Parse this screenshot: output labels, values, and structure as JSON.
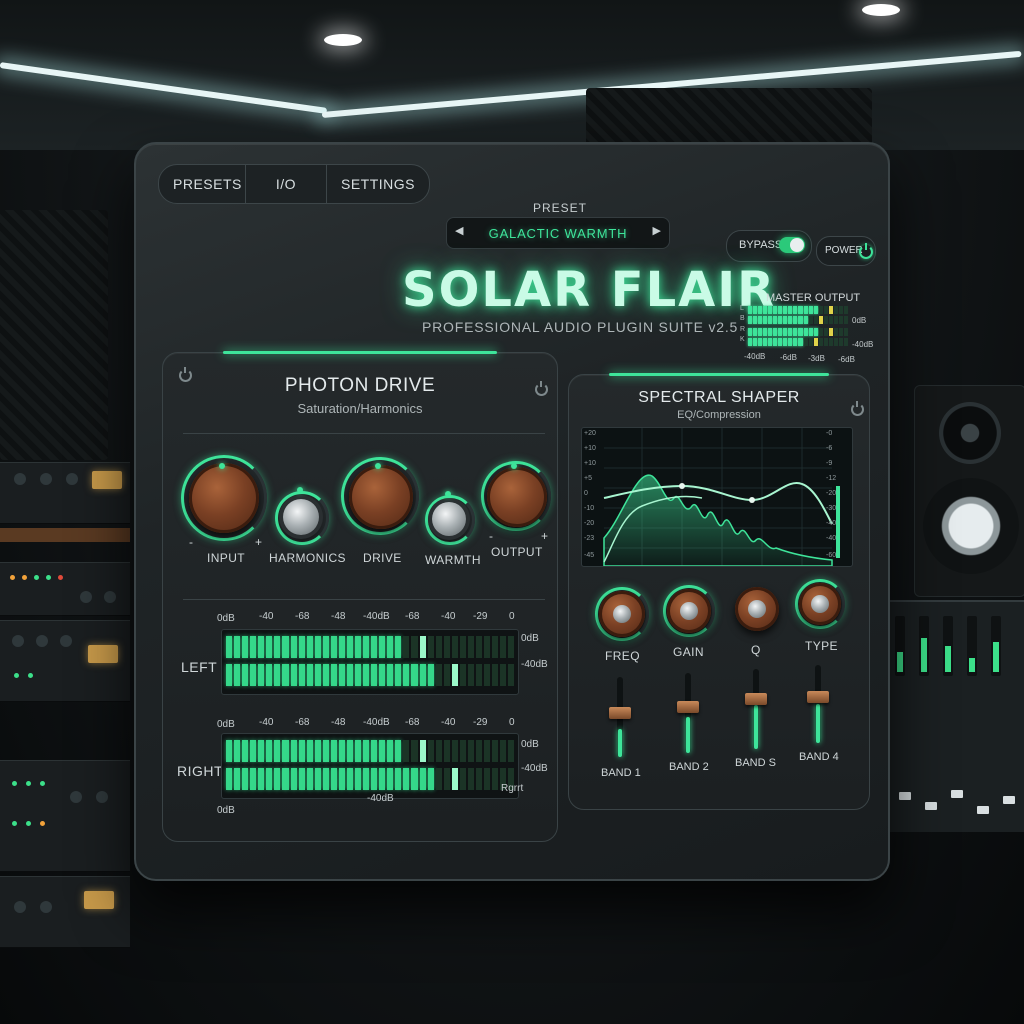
{
  "toolbar": {
    "tabs": [
      "PRESETS",
      "I/O",
      "SETTINGS"
    ],
    "preset_label": "PRESET",
    "preset_name": "GALACTIC WARMTH",
    "bypass_label": "BYPASS",
    "bypass_on": true,
    "power_label": "POWER"
  },
  "header": {
    "title": "SOLAR FLAIR",
    "subtitle": "PROFESSIONAL AUDIO PLUGIN SUITE v2.5"
  },
  "master_output": {
    "label": "MASTER OUTPUT",
    "channels": [
      "L",
      "R"
    ],
    "channel_sublabels": [
      "B",
      "K"
    ],
    "db_right_top": "0dB",
    "db_right_bottom": "-40dB",
    "scale": [
      "-40dB",
      "-6dB",
      "-3dB",
      "-6dB"
    ],
    "levels": [
      0.72,
      0.6,
      0.68,
      0.55
    ]
  },
  "photon_drive": {
    "title": "PHOTON DRIVE",
    "subtitle": "Saturation/Harmonics",
    "knobs": [
      {
        "label": "INPUT",
        "style": "wood"
      },
      {
        "label": "HARMONICS",
        "style": "metal"
      },
      {
        "label": "DRIVE",
        "style": "wood"
      },
      {
        "label": "WARMTH",
        "style": "metal"
      },
      {
        "label": "OUTPUT",
        "style": "wood"
      }
    ],
    "knob_minus": "-",
    "knob_plus": "+",
    "meters": {
      "left": {
        "label": "LEFT",
        "scale": [
          "0dB",
          "-40",
          "-68",
          "-48",
          "-40dB",
          "-68",
          "-40",
          "-29",
          "0"
        ],
        "right_top": "0dB",
        "right_bottom": "-40dB",
        "levels": [
          0.62,
          0.72
        ]
      },
      "right": {
        "label": "RIGHT",
        "scale": [
          "0dB",
          "-40",
          "-68",
          "-48",
          "-40dB",
          "-68",
          "-40",
          "-29",
          "0"
        ],
        "right_top": "0dB",
        "right_bottom": "-40dB",
        "bottom_left": "0dB",
        "bottom_mid": "-40dB",
        "bottom_right": "Rgrrt",
        "levels": [
          0.62,
          0.72
        ]
      }
    }
  },
  "spectral_shaper": {
    "title": "SPECTRAL SHAPER",
    "subtitle": "EQ/Compression",
    "eq_scale_left": [
      "+20",
      "+10",
      "+10",
      "+5",
      "0",
      "-10",
      "-20",
      "-23",
      "-45"
    ],
    "eq_scale_right": [
      "-0",
      "-6",
      "-9",
      "-12",
      "-20",
      "-30",
      "-40",
      "-40",
      "-60"
    ],
    "knobs": [
      "FREQ",
      "GAIN",
      "Q",
      "TYPE"
    ],
    "bands": [
      {
        "label": "BAND 1",
        "level": 0.35
      },
      {
        "label": "BAND 2",
        "level": 0.45
      },
      {
        "label": "BAND S",
        "level": 0.55
      },
      {
        "label": "BAND 4",
        "level": 0.5
      }
    ]
  },
  "colors": {
    "accent": "#3ee49a",
    "panel": "#1f2426",
    "wood": "#7a4024"
  }
}
